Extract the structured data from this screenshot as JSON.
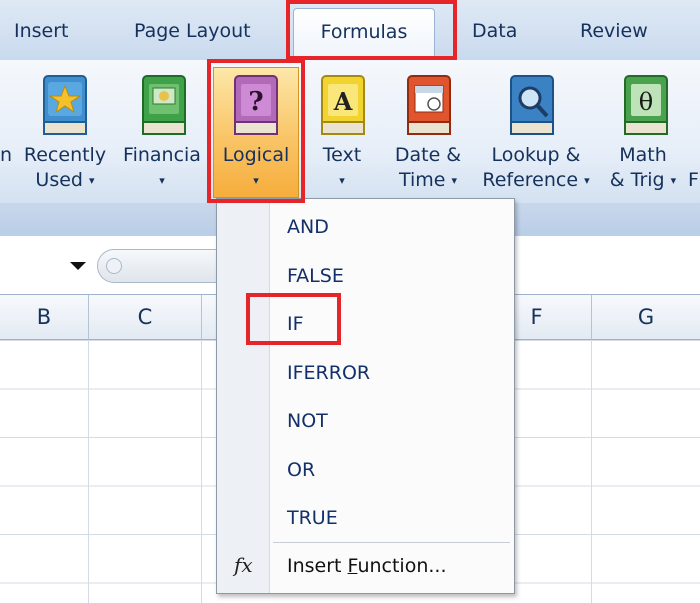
{
  "tabs": {
    "insert": "Insert",
    "page_layout": "Page Layout",
    "formulas": "Formulas",
    "data": "Data",
    "review": "Review"
  },
  "ribbon": {
    "partial_left": "n",
    "recently_used": [
      "Recently",
      "Used"
    ],
    "financial": "Financia",
    "logical": "Logical",
    "text": "Text",
    "date_time": [
      "Date &",
      "Time"
    ],
    "lookup_reference": [
      "Lookup &",
      "Reference"
    ],
    "math_trig": [
      "Math",
      "& Trig"
    ],
    "partial_right": "F",
    "dropdown_arrow": "▾"
  },
  "columns": [
    "B",
    "C",
    "F",
    "G"
  ],
  "logical_menu": {
    "items": [
      "AND",
      "FALSE",
      "IF",
      "IFERROR",
      "NOT",
      "OR",
      "TRUE"
    ],
    "insert_function_icon": "fx",
    "insert_function_prefix": "Insert ",
    "insert_function_accel": "F",
    "insert_function_rest": "unction..."
  },
  "colors": {
    "highlight_red": "#e5252a",
    "menu_text": "#13306a",
    "ribbon_text": "#15315c"
  }
}
